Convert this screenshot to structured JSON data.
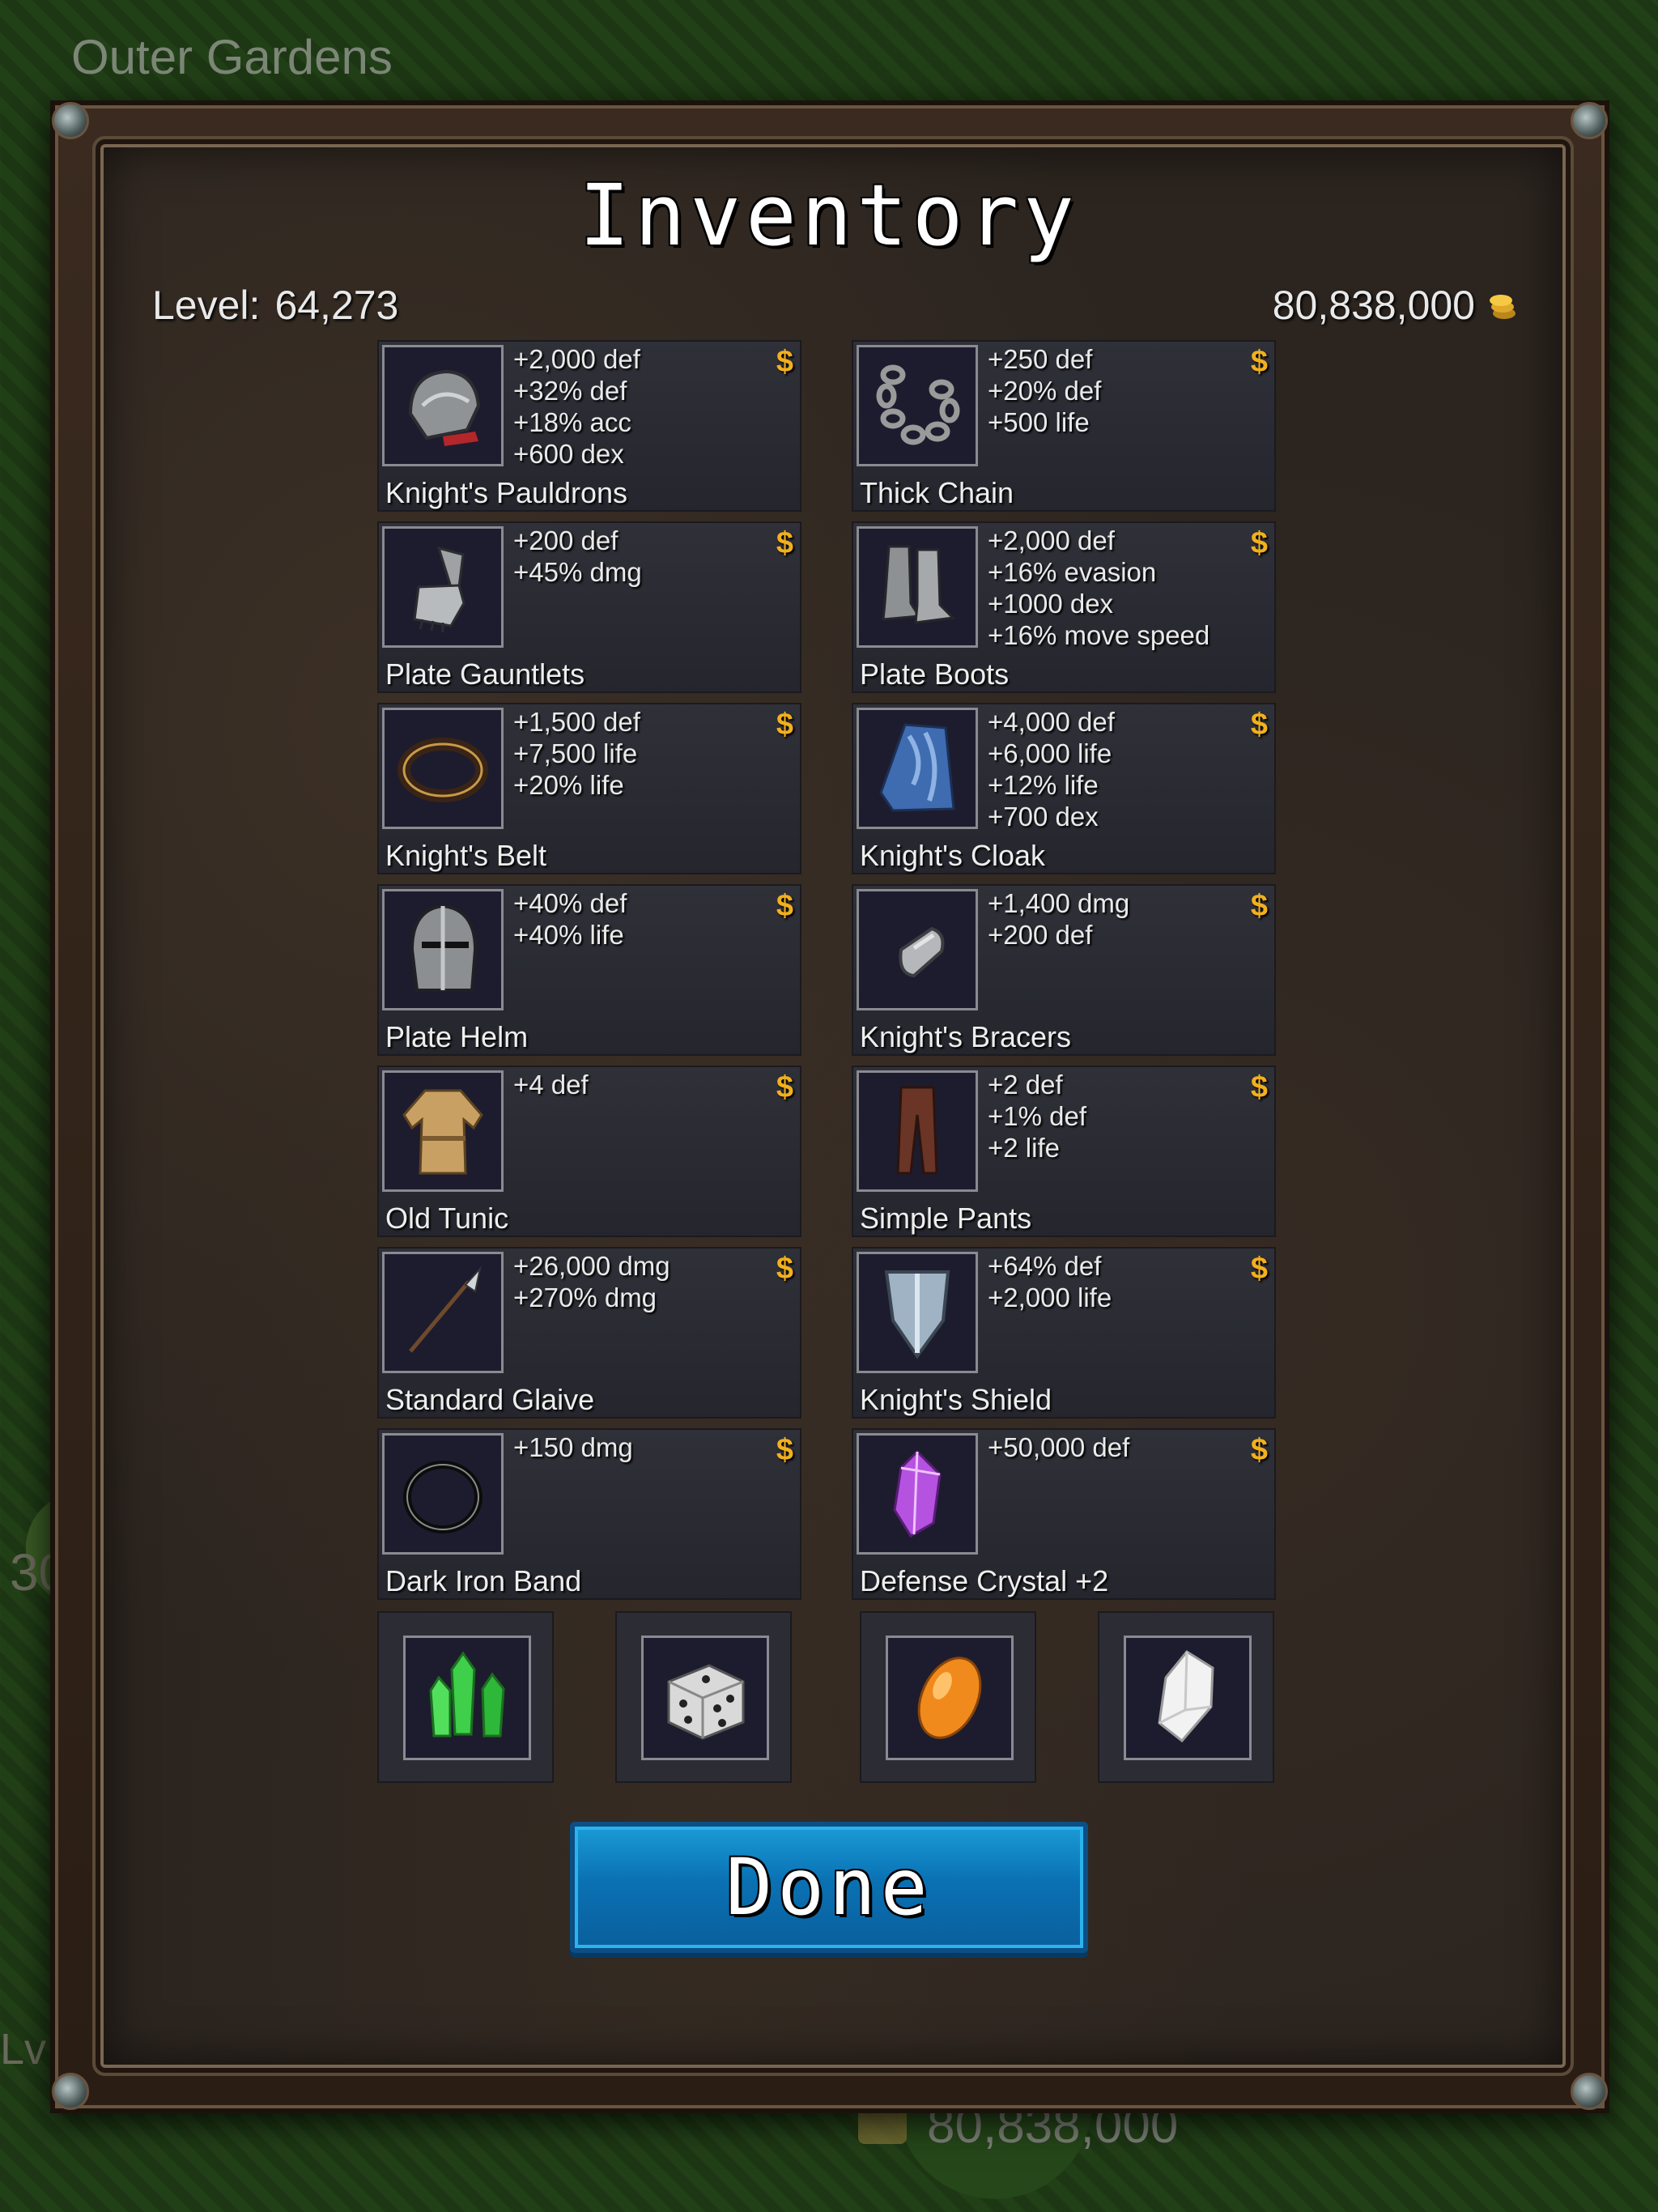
{
  "background": {
    "area_name": "Outer Gardens",
    "gold_display": "80,838,000",
    "side_number": "30",
    "side_label": "Lv"
  },
  "dialog": {
    "title": "Inventory",
    "level_label": "Level:",
    "level_value": "64,273",
    "gold_value": "80,838,000",
    "done_label": "Done"
  },
  "items": [
    {
      "name": "Knight's Pauldrons",
      "icon": "pauldron-icon",
      "sell": "$",
      "stats": [
        "+2,000 def",
        "+32% def",
        "+18% acc",
        "+600 dex"
      ]
    },
    {
      "name": "Thick Chain",
      "icon": "chain-icon",
      "sell": "$",
      "stats": [
        "+250 def",
        "+20% def",
        "+500 life"
      ]
    },
    {
      "name": "Plate Gauntlets",
      "icon": "gauntlet-icon",
      "sell": "$",
      "stats": [
        "+200 def",
        "+45% dmg"
      ]
    },
    {
      "name": "Plate Boots",
      "icon": "boots-icon",
      "sell": "$",
      "stats": [
        "+2,000 def",
        "+16% evasion",
        "+1000 dex",
        "+16% move speed"
      ]
    },
    {
      "name": "Knight's Belt",
      "icon": "belt-icon",
      "sell": "$",
      "stats": [
        "+1,500 def",
        "+7,500 life",
        "+20% life"
      ]
    },
    {
      "name": "Knight's Cloak",
      "icon": "cloak-icon",
      "sell": "$",
      "stats": [
        "+4,000 def",
        "+6,000 life",
        "+12% life",
        "+700 dex"
      ]
    },
    {
      "name": "Plate Helm",
      "icon": "helm-icon",
      "sell": "$",
      "stats": [
        "+40% def",
        "+40% life"
      ]
    },
    {
      "name": "Knight's Bracers",
      "icon": "bracer-icon",
      "sell": "$",
      "stats": [
        "+1,400 dmg",
        "+200 def"
      ]
    },
    {
      "name": "Old Tunic",
      "icon": "tunic-icon",
      "sell": "$",
      "stats": [
        "+4 def"
      ]
    },
    {
      "name": "Simple Pants",
      "icon": "pants-icon",
      "sell": "$",
      "stats": [
        "+2 def",
        "+1% def",
        "+2 life"
      ]
    },
    {
      "name": "Standard Glaive",
      "icon": "glaive-icon",
      "sell": "$",
      "stats": [
        "+26,000 dmg",
        "+270% dmg"
      ]
    },
    {
      "name": "Knight's Shield",
      "icon": "shield-icon",
      "sell": "$",
      "stats": [
        "+64% def",
        "+2,000 life"
      ]
    },
    {
      "name": "Dark Iron Band",
      "icon": "ring-icon",
      "sell": "$",
      "stats": [
        "+150 dmg"
      ]
    },
    {
      "name": "Defense Crystal +2",
      "icon": "purple-crystal-icon",
      "sell": "$",
      "stats": [
        "+50,000 def"
      ]
    }
  ],
  "consumables": [
    {
      "icon": "green-crystal-icon"
    },
    {
      "icon": "dice-icon"
    },
    {
      "icon": "orange-gem-icon"
    },
    {
      "icon": "white-crystal-icon"
    }
  ]
}
